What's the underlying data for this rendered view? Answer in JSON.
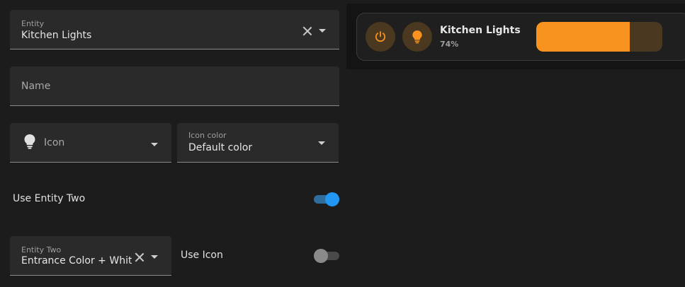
{
  "editor": {
    "entity": {
      "label": "Entity",
      "value": "Kitchen Lights"
    },
    "name": {
      "placeholder": "Name"
    },
    "icon": {
      "placeholder": "Icon",
      "icon": "lightbulb-icon"
    },
    "icon_color": {
      "label": "Icon color",
      "value": "Default color"
    },
    "use_entity_two": {
      "label": "Use Entity Two",
      "checked": true
    },
    "entity_two": {
      "label": "Entity Two",
      "value": "Entrance Color + White L"
    },
    "use_icon": {
      "label": "Use Icon",
      "checked": false
    }
  },
  "preview": {
    "title": "Kitchen Lights",
    "state": "74%",
    "brightness": 0.74,
    "power_icon": "power-icon",
    "bulb_icon": "lightbulb-icon"
  },
  "colors": {
    "accent": "#f7931e",
    "accent_bg": "#4a3820",
    "toggle_on": "#2196f3",
    "toggle_on_track": "#2f6d9c",
    "toggle_off": "#8a8a8a"
  }
}
